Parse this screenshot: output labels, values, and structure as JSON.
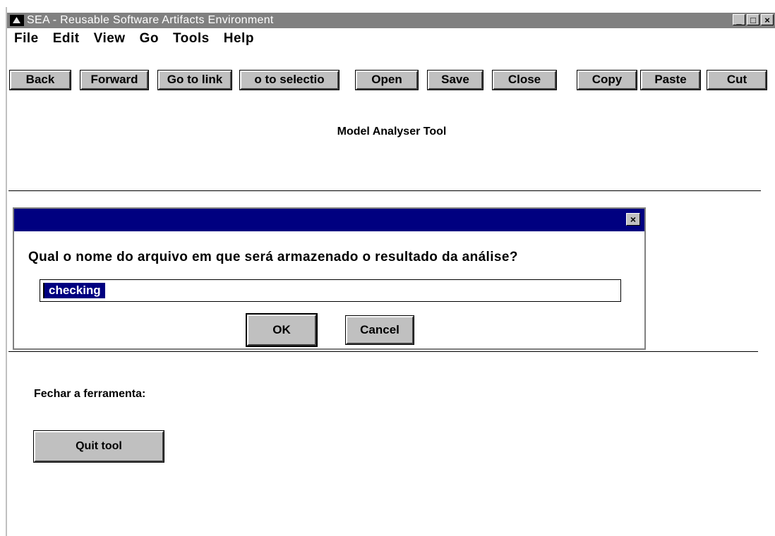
{
  "window": {
    "title": "SEA - Reusable Software Artifacts Environment",
    "controls": {
      "minimize": "_",
      "maximize": "□",
      "close": "×"
    }
  },
  "menu": [
    "File",
    "Edit",
    "View",
    "Go",
    "Tools",
    "Help"
  ],
  "toolbar": {
    "back": "Back",
    "forward": "Forward",
    "go_to_link": "Go to link",
    "go_to_selection": "o to selectio",
    "open": "Open",
    "save": "Save",
    "close": "Close",
    "copy": "Copy",
    "paste": "Paste",
    "cut": "Cut"
  },
  "content": {
    "heading": "Model Analyser Tool",
    "quit_label": "Fechar a ferramenta:",
    "quit_button": "Quit tool"
  },
  "dialog": {
    "close": "×",
    "prompt": "Qual o nome do arquivo em que será armazenado o resultado da análise?",
    "input_value": "checking",
    "ok": "OK",
    "cancel": "Cancel"
  }
}
